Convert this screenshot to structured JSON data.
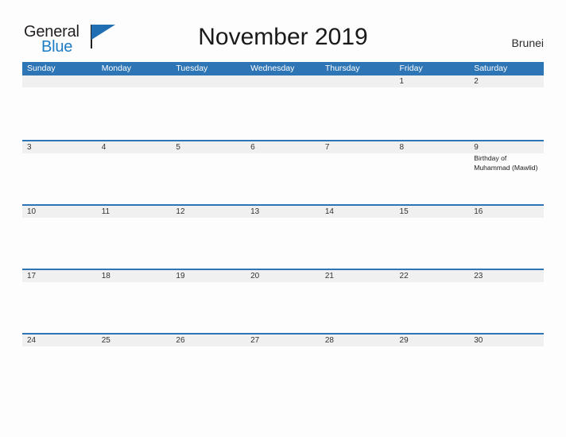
{
  "brand": {
    "name_part1": "General",
    "name_part2": "Blue",
    "flag_icon": "blue-triangle-flag-icon"
  },
  "header": {
    "month_title": "November 2019",
    "country": "Brunei",
    "accent_color": "#2e75b6",
    "band_color": "#f0f0f0"
  },
  "calendar": {
    "weekdays": [
      "Sunday",
      "Monday",
      "Tuesday",
      "Wednesday",
      "Thursday",
      "Friday",
      "Saturday"
    ],
    "weeks": [
      {
        "days": [
          {
            "number": "",
            "events": []
          },
          {
            "number": "",
            "events": []
          },
          {
            "number": "",
            "events": []
          },
          {
            "number": "",
            "events": []
          },
          {
            "number": "",
            "events": []
          },
          {
            "number": "1",
            "events": []
          },
          {
            "number": "2",
            "events": []
          }
        ]
      },
      {
        "days": [
          {
            "number": "3",
            "events": []
          },
          {
            "number": "4",
            "events": []
          },
          {
            "number": "5",
            "events": []
          },
          {
            "number": "6",
            "events": []
          },
          {
            "number": "7",
            "events": []
          },
          {
            "number": "8",
            "events": []
          },
          {
            "number": "9",
            "events": [
              "Birthday of Muhammad (Mawlid)"
            ]
          }
        ]
      },
      {
        "days": [
          {
            "number": "10",
            "events": []
          },
          {
            "number": "11",
            "events": []
          },
          {
            "number": "12",
            "events": []
          },
          {
            "number": "13",
            "events": []
          },
          {
            "number": "14",
            "events": []
          },
          {
            "number": "15",
            "events": []
          },
          {
            "number": "16",
            "events": []
          }
        ]
      },
      {
        "days": [
          {
            "number": "17",
            "events": []
          },
          {
            "number": "18",
            "events": []
          },
          {
            "number": "19",
            "events": []
          },
          {
            "number": "20",
            "events": []
          },
          {
            "number": "21",
            "events": []
          },
          {
            "number": "22",
            "events": []
          },
          {
            "number": "23",
            "events": []
          }
        ]
      },
      {
        "days": [
          {
            "number": "24",
            "events": []
          },
          {
            "number": "25",
            "events": []
          },
          {
            "number": "26",
            "events": []
          },
          {
            "number": "27",
            "events": []
          },
          {
            "number": "28",
            "events": []
          },
          {
            "number": "29",
            "events": []
          },
          {
            "number": "30",
            "events": []
          }
        ]
      }
    ]
  }
}
